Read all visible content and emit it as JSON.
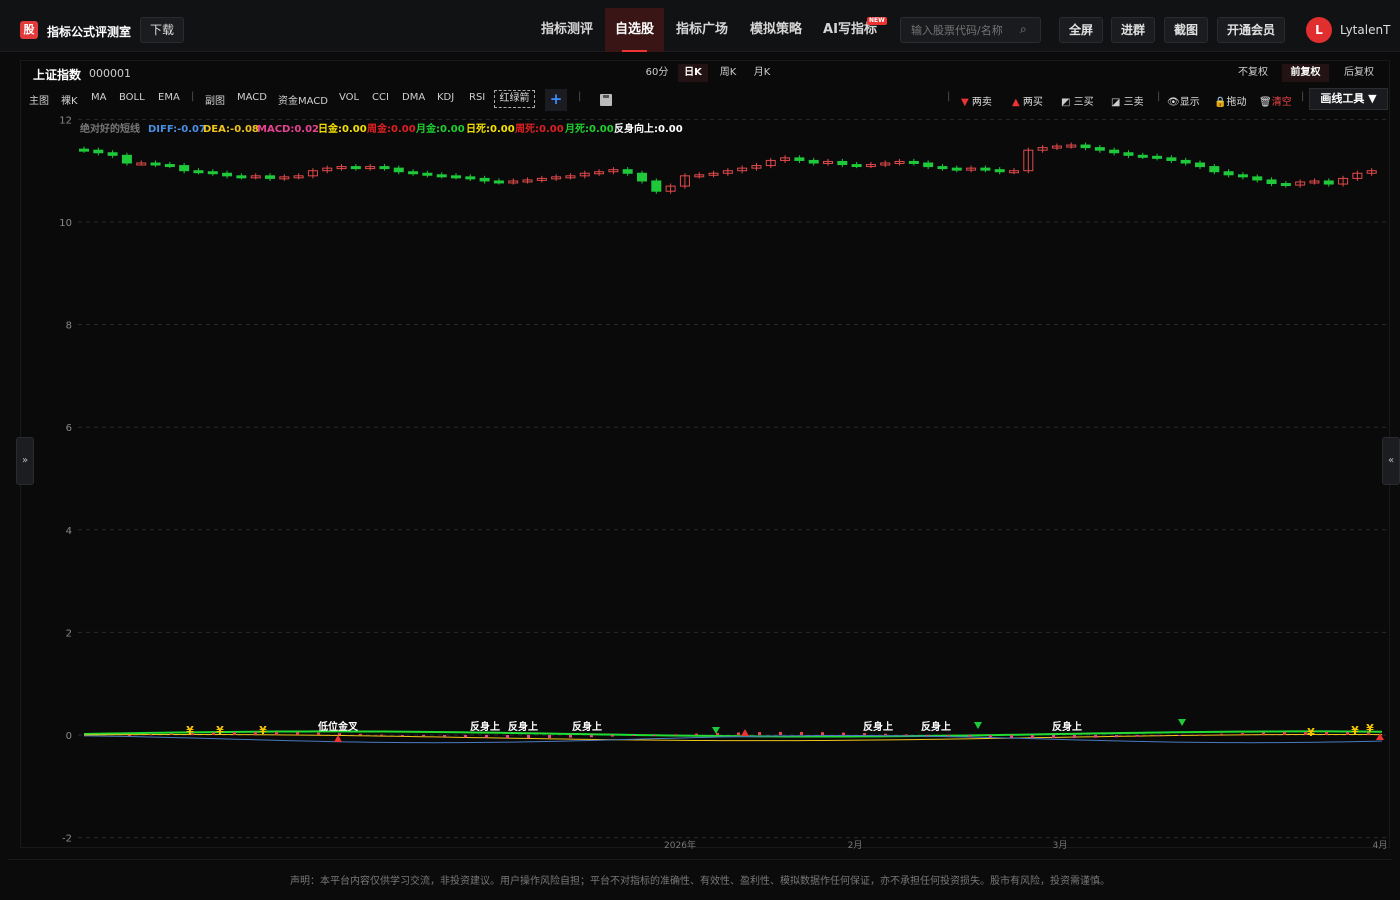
{
  "app": {
    "logo_char": "股",
    "brand": "指标公式评测室",
    "download": "下载"
  },
  "nav": [
    {
      "label": "指标测评",
      "active": false
    },
    {
      "label": "自选股",
      "active": true
    },
    {
      "label": "指标广场",
      "active": false
    },
    {
      "label": "模拟策略",
      "active": false
    },
    {
      "label": "AI写指标",
      "active": false,
      "badge": "NEW"
    }
  ],
  "search": {
    "placeholder": "输入股票代码/名称"
  },
  "toolbar": {
    "fullscreen": "全屏",
    "group": "进群",
    "screenshot": "截图",
    "vip": "开通会员"
  },
  "user": {
    "initial": "L",
    "name": "LytalenT"
  },
  "stock": {
    "name": "上证指数",
    "code": "000001"
  },
  "periods": [
    {
      "label": "60分",
      "active": false
    },
    {
      "label": "日K",
      "active": true
    },
    {
      "label": "周K",
      "active": false
    },
    {
      "label": "月K",
      "active": false
    }
  ],
  "adjust": [
    {
      "label": "不复权",
      "active": false
    },
    {
      "label": "前复权",
      "active": true
    },
    {
      "label": "后复权",
      "active": false
    }
  ],
  "indicators_main": [
    "主图",
    "裸K",
    "MA",
    "BOLL",
    "EMA"
  ],
  "indicators_sub": [
    "副图",
    "MACD",
    "资金MACD",
    "VOL",
    "CCI",
    "DMA",
    "KDJ",
    "RSI"
  ],
  "redgreen_label": "红绿箭",
  "draw_tools": {
    "two_sell": "两卖",
    "two_buy": "两买",
    "three_buy": "三买",
    "three_sell": "三卖",
    "show": "显示",
    "drag": "拖动",
    "clear": "清空",
    "draw_tool": "画线工具"
  },
  "legend": {
    "name": "绝对好的短线",
    "diff": "DIFF:-0.07",
    "dea": "DEA:-0.08",
    "macd": "MACD:0.02",
    "day_gold": "日金:0.00",
    "week_gold": "周金:0.00",
    "month_gold": "月金:0.00",
    "day_dead": "日死:0.00",
    "week_dead": "周死:0.00",
    "month_dead": "月死:0.00",
    "reverse": "反身向上:0.00"
  },
  "colors": {
    "up": "#e24a4a",
    "down": "#1fc93a",
    "accent": "#e33333",
    "diff": "#4a90e2",
    "dea": "#f0c419",
    "macd_pos": "#e24a4a"
  },
  "disclaimer": "声明：本平台内容仅供学习交流，非投资建议。用户操作风险自担；平台不对指标的准确性、有效性、盈利性、模拟数据作任何保证，亦不承担任何投资损失。股市有风险，投资需谨慎。",
  "chart_data": {
    "type": "candlestick",
    "yticks": [
      "12",
      "10",
      "8",
      "6",
      "4",
      "2",
      "0",
      "-2"
    ],
    "ylim": [
      -2,
      12
    ],
    "xlabels": [
      "2026年",
      "2月",
      "3月",
      "4月"
    ],
    "annotations": [
      "低位金叉",
      "反身上",
      "反身上",
      "反身上",
      "反身上",
      "反身上",
      "反身上"
    ],
    "closes": [
      11.4,
      11.35,
      11.3,
      11.15,
      11.15,
      11.12,
      11.1,
      11.0,
      10.98,
      10.95,
      10.9,
      10.88,
      10.9,
      10.85,
      10.88,
      10.9,
      11.0,
      11.05,
      11.08,
      11.05,
      11.08,
      11.05,
      10.98,
      10.95,
      10.92,
      10.9,
      10.88,
      10.85,
      10.8,
      10.78,
      10.8,
      10.82,
      10.85,
      10.88,
      10.9,
      10.95,
      10.98,
      11.02,
      10.95,
      10.8,
      10.6,
      10.7,
      10.9,
      10.92,
      10.95,
      11.0,
      11.05,
      11.1,
      11.2,
      11.25,
      11.2,
      11.15,
      11.18,
      11.12,
      11.1,
      11.12,
      11.15,
      11.18,
      11.15,
      11.08,
      11.05,
      11.02,
      11.05,
      11.02,
      10.98,
      11.0,
      11.4,
      11.45,
      11.48,
      11.5,
      11.45,
      11.4,
      11.35,
      11.3,
      11.28,
      11.25,
      11.2,
      11.15,
      11.08,
      10.98,
      10.92,
      10.88,
      10.82,
      10.75,
      10.72,
      10.78,
      10.8,
      10.74,
      10.85,
      10.95,
      11.0
    ]
  }
}
